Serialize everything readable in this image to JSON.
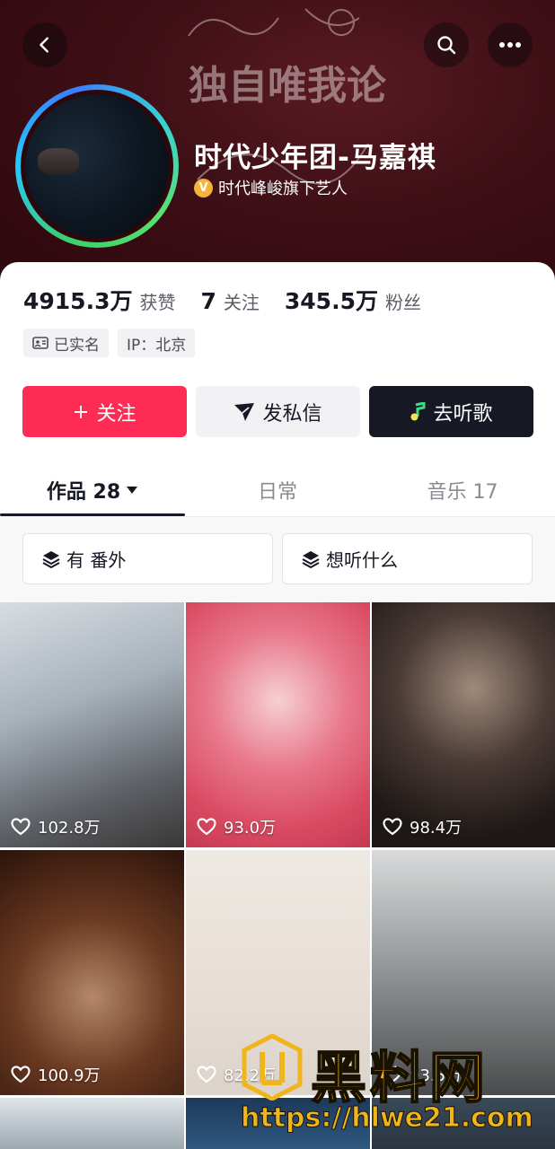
{
  "header": {
    "name": "时代少年团-马嘉祺",
    "verify_badge": "V",
    "verify_text": "时代峰峻旗下艺人",
    "banner_art_text": "独自唯我论"
  },
  "stats": {
    "likes_value": "4915.3万",
    "likes_label": "获赞",
    "following_value": "7",
    "following_label": "关注",
    "followers_value": "345.5万",
    "followers_label": "粉丝"
  },
  "tags": {
    "verified": "已实名",
    "ip": "IP：北京"
  },
  "actions": {
    "follow": "关注",
    "message": "发私信",
    "music": "去听歌"
  },
  "tabs": [
    {
      "label": "作品 28"
    },
    {
      "label": "日常"
    },
    {
      "label": "音乐 17"
    }
  ],
  "chips": [
    {
      "label": "有 番外"
    },
    {
      "label": "想听什么"
    }
  ],
  "videos": [
    {
      "likes": "102.8万"
    },
    {
      "likes": "93.0万"
    },
    {
      "likes": "98.4万"
    },
    {
      "likes": "100.9万"
    },
    {
      "likes": "82.2万"
    },
    {
      "likes": "93.5万"
    }
  ],
  "watermark": {
    "title": "黑料网",
    "url": "https://hlwe21.com"
  },
  "colors": {
    "accent": "#fe2c55",
    "dark_button": "#161823",
    "banner": "#3e0f16",
    "watermark": "#f1b51c"
  }
}
